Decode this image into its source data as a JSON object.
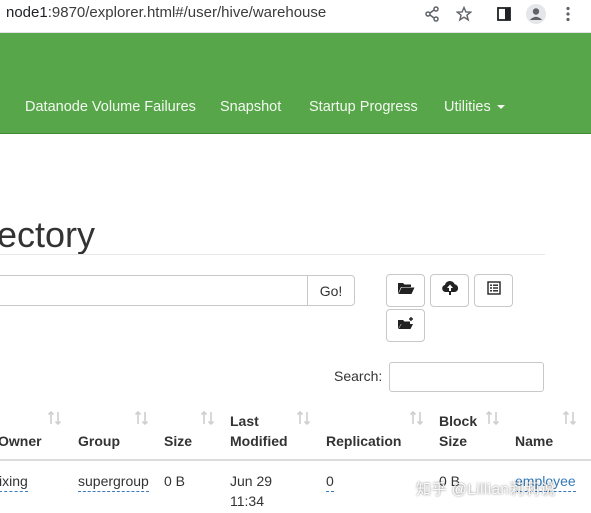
{
  "browser": {
    "url_host": "node1",
    "url_rest": ":9870/explorer.html#/user/hive/warehouse",
    "icons": [
      "share-icon",
      "star-icon",
      "side-panel-icon",
      "profile-icon",
      "kebab-menu-icon"
    ]
  },
  "navbar": {
    "items": [
      {
        "label": "Datanode Volume Failures"
      },
      {
        "label": "Snapshot"
      },
      {
        "label": "Startup Progress"
      },
      {
        "label": "Utilities",
        "dropdown": true
      }
    ],
    "bg_color": "#57a64a"
  },
  "page": {
    "title": "ectory"
  },
  "path_bar": {
    "value": "",
    "go_label": "Go!"
  },
  "toolbar_icons": [
    "open-folder-icon",
    "upload-cloud-icon",
    "list-view-icon",
    "new-folder-icon"
  ],
  "search": {
    "label": "Search:",
    "value": ""
  },
  "table": {
    "columns": [
      "Owner",
      "Group",
      "Size",
      "Last Modified",
      "Replication",
      "Block Size",
      "Name"
    ],
    "column_lines": [
      [
        "Owner"
      ],
      [
        "Group"
      ],
      [
        "Size"
      ],
      [
        "Last",
        "Modified"
      ],
      [
        "Replication"
      ],
      [
        "Block",
        "Size"
      ],
      [
        "Name"
      ]
    ],
    "rows": [
      {
        "owner": "ixing",
        "group": "supergroup",
        "size": "0 B",
        "modified_date": "Jun 29",
        "modified_time": "11:34",
        "replication": "0",
        "block_size": "0 B",
        "name": "employee"
      }
    ]
  },
  "watermark": "知乎 @Lillian莉莉说"
}
